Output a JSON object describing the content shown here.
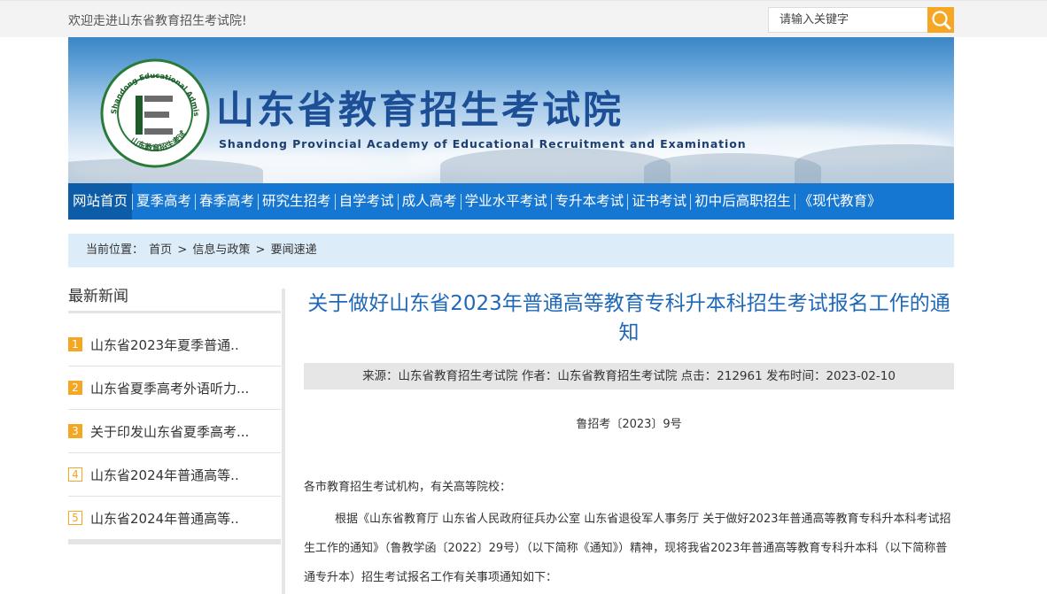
{
  "topbar": {
    "welcome": "欢迎走进山东省教育招生考试院!",
    "search_placeholder": "请输入关键字"
  },
  "banner": {
    "title": "山东省教育招生考试院",
    "subtitle": "Shandong Provincial Academy of Educational Recruitment and Examination",
    "logo_ring_top": "Shandong Educational Admission & Examinations",
    "logo_ring_bottom": "山东教育招生考试",
    "logo_letter": "E"
  },
  "nav": {
    "items": [
      {
        "label": "网站首页"
      },
      {
        "label": "夏季高考"
      },
      {
        "label": "春季高考"
      },
      {
        "label": "研究生招考"
      },
      {
        "label": "自学考试"
      },
      {
        "label": "成人高考"
      },
      {
        "label": "学业水平考试"
      },
      {
        "label": "专升本考试"
      },
      {
        "label": "证书考试"
      },
      {
        "label": "初中后高职招生"
      },
      {
        "label": "《现代教育》"
      }
    ]
  },
  "breadcrumb": {
    "prefix": "当前位置：",
    "items": [
      "首页",
      "信息与政策",
      "要闻速递"
    ],
    "separator": ">"
  },
  "sidebar": {
    "title": "最新新闻",
    "items": [
      {
        "num": "1",
        "text": "山东省2023年夏季普通.."
      },
      {
        "num": "2",
        "text": "山东省夏季高考外语听力..."
      },
      {
        "num": "3",
        "text": "关于印发山东省夏季高考..."
      },
      {
        "num": "4",
        "text": "山东省2024年普通高等.."
      },
      {
        "num": "5",
        "text": "山东省2024年普通高等.."
      }
    ]
  },
  "article": {
    "title": "关于做好山东省2023年普通高等教育专科升本科招生考试报名工作的通知",
    "meta": "来源：山东省教育招生考试院 作者：山东省教育招生考试院 点击：212961 发布时间：2023-02-10",
    "doc_number": "鲁招考〔2023〕9号",
    "salutation": "各市教育招生考试机构，有关高等院校：",
    "body": "根据《山东省教育厅 山东省人民政府征兵办公室 山东省退役军人事务厅 关于做好2023年普通高等教育专科升本科考试招生工作的通知》（鲁教学函〔2022〕29号）（以下简称《通知》）精神，现将我省2023年普通高等教育专科升本科（以下简称普通专升本）招生考试报名工作有关事项通知如下："
  },
  "colors": {
    "nav_bg": "#1677d2",
    "nav_active": "#0c5ca8",
    "accent_orange": "#f5a623",
    "title_blue": "#1f68b8",
    "breadcrumb_bg": "#ddecf9"
  }
}
